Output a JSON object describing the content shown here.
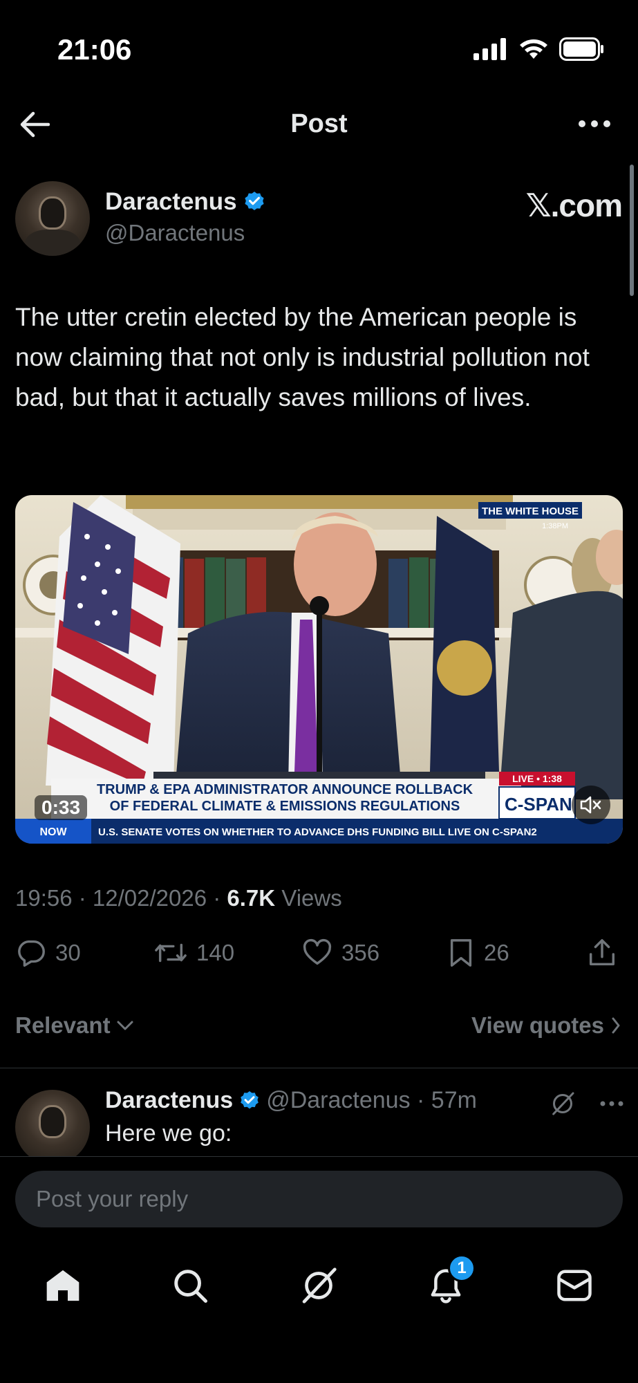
{
  "status_bar": {
    "time": "21:06"
  },
  "header": {
    "title": "Post"
  },
  "post": {
    "author_name": "Daractenus",
    "author_handle": "@Daractenus",
    "brand": "𝕏.com",
    "text": "The utter cretin elected by the American people is now claiming that not only is industrial pollution not bad, but that it actually saves millions of lives.",
    "media": {
      "duration": "0:33",
      "top_badge": "THE WHITE HOUSE",
      "top_badge_time": "1:38PM",
      "live_label": "LIVE • 1:38",
      "headline_line1": "TRUMP & EPA ADMINISTRATOR ANNOUNCE ROLLBACK",
      "headline_line2": "OF FEDERAL CLIMATE & EMISSIONS REGULATIONS",
      "network": "C-SPAN",
      "now_label": "NOW",
      "ticker": "U.S. SENATE VOTES ON WHETHER TO ADVANCE DHS FUNDING BILL   LIVE ON C-SPAN2"
    },
    "timestamp": "19:56 · 12/02/2026 · ",
    "views_count": "6.7K",
    "views_label": " Views",
    "stats": {
      "replies": "30",
      "reposts": "140",
      "likes": "356",
      "bookmarks": "26"
    }
  },
  "filter": {
    "sort_label": "Relevant",
    "view_quotes": "View quotes"
  },
  "reply": {
    "author_name": "Daractenus",
    "meta": "@Daractenus · 57m",
    "text": "Here we go:"
  },
  "reply_box": {
    "placeholder": "Post your reply"
  },
  "tabbar": {
    "notification_count": "1"
  },
  "colors": {
    "accent": "#1d9bf0",
    "background": "#000000",
    "muted": "#71767b",
    "text": "#e7e9ea"
  }
}
